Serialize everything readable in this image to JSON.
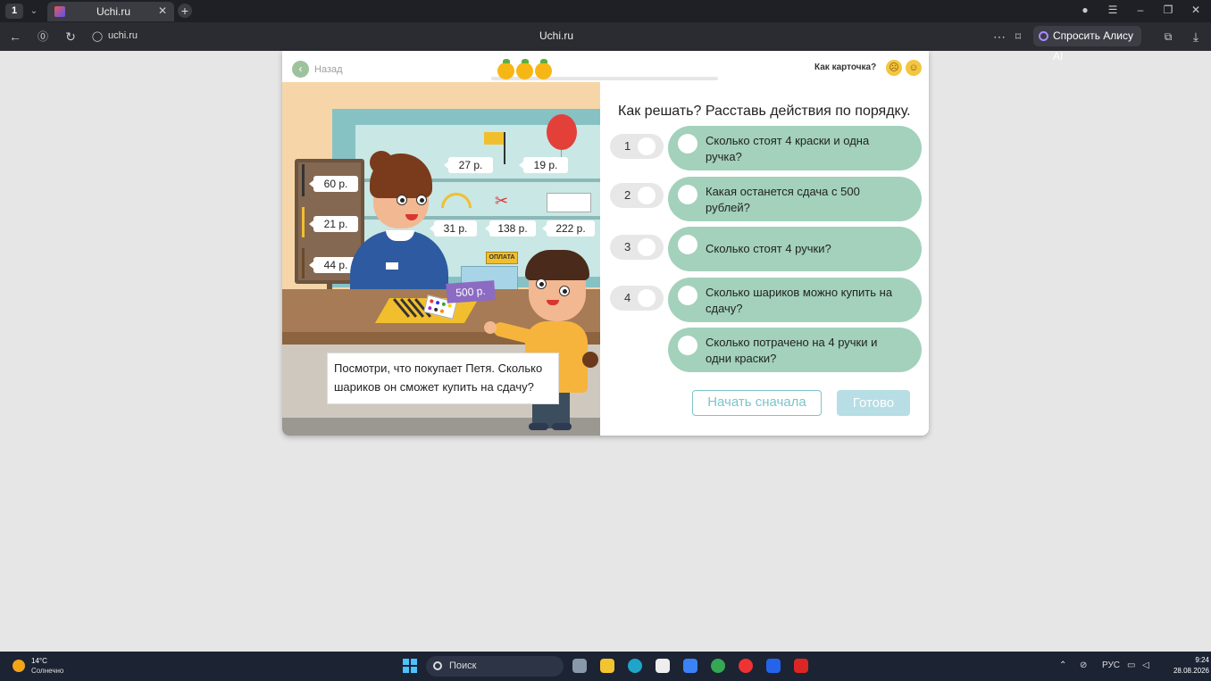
{
  "browser": {
    "workspace": "1",
    "tab_title": "Uchi.ru",
    "url": "uchi.ru",
    "page_title": "Uchi.ru",
    "alisa_label": "Спросить Алису AI"
  },
  "card": {
    "back_label": "Назад",
    "rating_label": "Как карточка?",
    "progress_oranges": 3
  },
  "scene": {
    "price_tags": [
      "60 р.",
      "21 р.",
      "44 р.",
      "27 р.",
      "19 р.",
      "31 р.",
      "138 р.",
      "222 р."
    ],
    "money_label": "500 р.",
    "register_label": "ОПЛАТА",
    "speech": "Посмотри, что покупает Петя. Сколько шариков он сможет купить на сдачу?"
  },
  "task": {
    "title": "Как решать? Расставь действия по порядку.",
    "slots": [
      "1",
      "2",
      "3",
      "4"
    ],
    "options": [
      "Сколько стоят 4 краски и одна ручка?",
      "Какая останется сдача с 500 рублей?",
      "Сколько стоят 4 ручки?",
      "Сколько шариков можно купить на сдачу?",
      "Сколько потрачено на 4 ручки и одни краски?"
    ],
    "restart_label": "Начать сначала",
    "done_label": "Готово"
  },
  "taskbar": {
    "temperature": "14°C",
    "condition": "Солнечно",
    "search_placeholder": "Поиск",
    "language": "РУС",
    "time": "9:24",
    "date": "28.08.2026"
  },
  "colors": {
    "option_bg": "#a3d1bb",
    "accent": "#7ec4ca",
    "orange": "#f6b614"
  }
}
